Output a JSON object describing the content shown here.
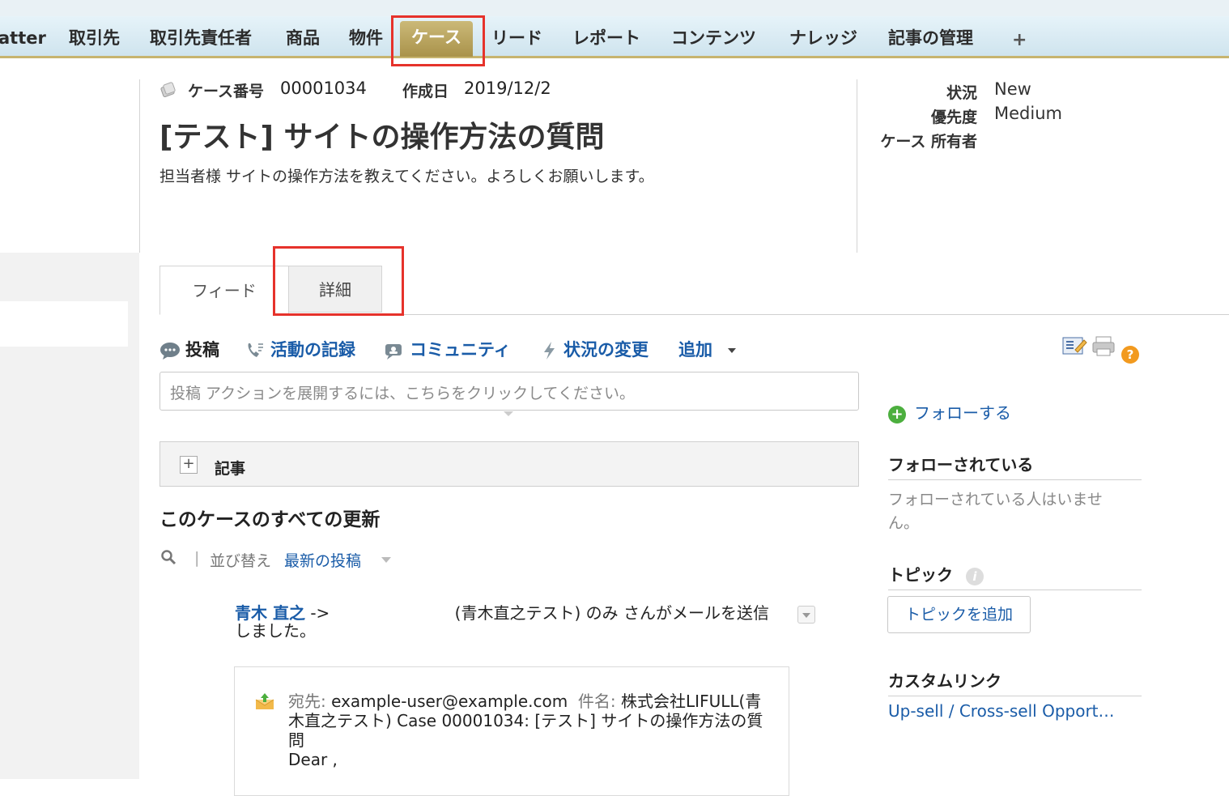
{
  "nav": {
    "tabs": [
      {
        "label": "atter"
      },
      {
        "label": "取引先"
      },
      {
        "label": "取引先責任者"
      },
      {
        "label": "商品"
      },
      {
        "label": "物件"
      },
      {
        "label": "ケース"
      },
      {
        "label": "リード"
      },
      {
        "label": "レポート"
      },
      {
        "label": "コンテンツ"
      },
      {
        "label": "ナレッジ"
      },
      {
        "label": "記事の管理"
      }
    ],
    "add_label": "+"
  },
  "header": {
    "case_number_label": "ケース番号",
    "case_number": "00001034",
    "created_label": "作成日",
    "created_value": "2019/12/2",
    "title": "[テスト] サイトの操作方法の質問",
    "description": "担当者様 サイトの操作方法を教えてください。よろしくお願いします。"
  },
  "sidebar_fields": {
    "status_label": "状況",
    "status_value": "New",
    "priority_label": "優先度",
    "priority_value": "Medium",
    "owner_label": "ケース 所有者"
  },
  "tabs": {
    "feed": "フィード",
    "detail": "詳細"
  },
  "publisher": {
    "post": "投稿",
    "log_activity": "活動の記録",
    "community": "コミュニティ",
    "change_status": "状況の変更",
    "more": "追加",
    "placeholder": "投稿 アクションを展開するには、こちらをクリックしてください。"
  },
  "articles_label": "記事",
  "updates": {
    "title": "このケースのすべての更新",
    "sort_label": "並び替え",
    "sort_value": "最新の投稿",
    "separator": "|"
  },
  "feed_item": {
    "author": "青木 直之",
    "arrow": " -> ",
    "recipient_tail": "(青木直之テスト) のみ さんがメールを送信",
    "line2": "しました。",
    "to_label": "宛先:",
    "to_value": "example-user@example.com",
    "subject_label": "件名:",
    "subject_value": "株式会社LIFULL(青木直之テスト) Case 00001034: [テスト] サイトの操作方法の質問",
    "body": "Dear ,"
  },
  "right": {
    "follow": "フォローする",
    "followers_heading": "フォローされている",
    "followers_empty": "フォローされている人はいません。",
    "topics_heading": "トピック",
    "add_topic": "トピックを追加",
    "custom_links_heading": "カスタムリンク",
    "custom_link": "Up-sell / Cross-sell Opportunity"
  },
  "colors": {
    "link": "#1a5ca8",
    "active_tab": "#b09a52",
    "highlight": "#e6322b"
  }
}
